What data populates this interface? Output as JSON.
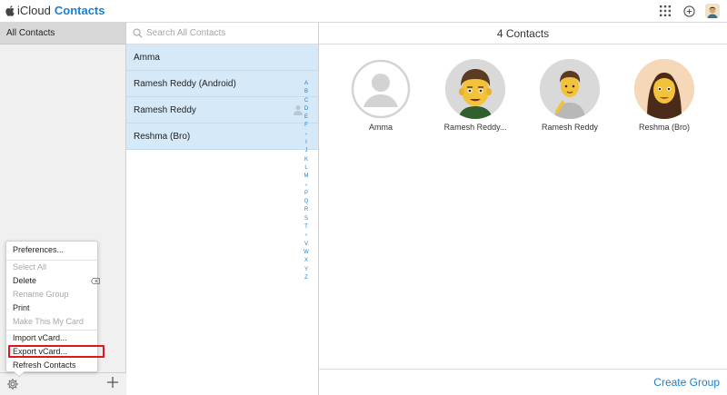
{
  "header": {
    "brand_prefix": "iCloud",
    "app_name": "Contacts",
    "icons": [
      "apple-icon",
      "app-grid-icon",
      "add-icon",
      "account-avatar-icon"
    ]
  },
  "sidebar": {
    "group_label": "All Contacts"
  },
  "menu": {
    "items": [
      {
        "label": "Preferences...",
        "disabled": false
      },
      {
        "label": "Select All",
        "disabled": true
      },
      {
        "label": "Delete",
        "disabled": false
      },
      {
        "label": "Rename Group",
        "disabled": true
      },
      {
        "label": "Print",
        "disabled": false
      },
      {
        "label": "Make This My Card",
        "disabled": true
      },
      {
        "label": "Import vCard...",
        "disabled": false
      },
      {
        "label": "Export vCard...",
        "disabled": false,
        "highlighted": true
      },
      {
        "label": "Refresh Contacts",
        "disabled": false
      }
    ]
  },
  "search": {
    "placeholder": "Search All Contacts"
  },
  "contacts": [
    "Amma",
    "Ramesh Reddy (Android)",
    "Ramesh Reddy",
    "Reshma (Bro)"
  ],
  "alphabet": [
    "A",
    "B",
    "C",
    "D",
    "E",
    "F",
    "•",
    "I",
    "J",
    "K",
    "L",
    "M",
    "•",
    "P",
    "Q",
    "R",
    "S",
    "T",
    "•",
    "V",
    "W",
    "X",
    "Y",
    "Z"
  ],
  "detail": {
    "count_label": "4 Contacts",
    "cards": [
      "Amma",
      "Ramesh Reddy...",
      "Ramesh Reddy",
      "Reshma (Bro)"
    ],
    "create_group_label": "Create Group"
  },
  "colors": {
    "accent": "#1a7fd0",
    "selected_row": "#d6e9f8",
    "highlight_border": "#e0151e"
  }
}
